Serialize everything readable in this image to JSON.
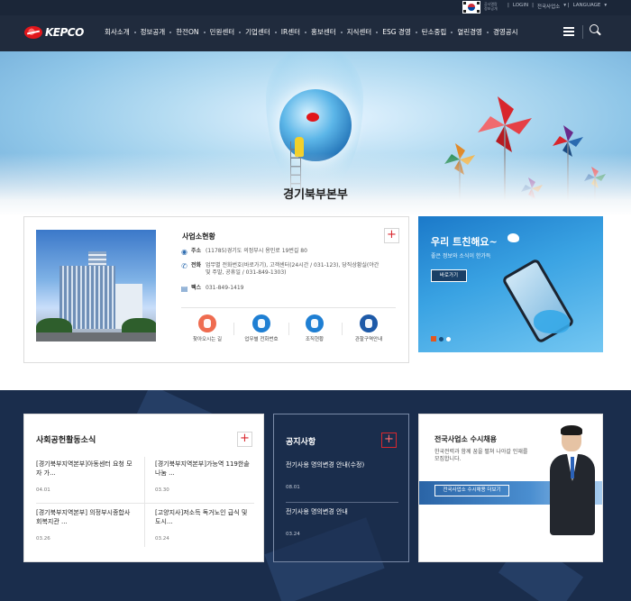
{
  "utility": {
    "flag_label": "Korean flag",
    "sub_lines": [
      "공사열람",
      "정보공개"
    ],
    "links": [
      "LOGIN",
      "전국사업소",
      "LANGUAGE"
    ]
  },
  "logo": {
    "text": "KEPCO"
  },
  "gnb": {
    "items": [
      "회사소개",
      "정보공개",
      "한전ON",
      "민원센터",
      "기업센터",
      "IR센터",
      "홍보센터",
      "지식센터",
      "ESG 경영",
      "탄소중립",
      "열린경영",
      "경영공시"
    ]
  },
  "hero": {
    "title": "경기북부본부"
  },
  "office": {
    "heading": "사업소현황",
    "address_label": "주소",
    "address": "(11785)경기도 의정부시 용민로 19번길 80",
    "phone_label": "전화",
    "phone": "업무별 전화번호(바로가기), 고객센터(24시간 / 031-123), 당직상황실(야간 및 주말, 공휴일 / 031-849-1303)",
    "fax_label": "팩스",
    "fax": "031-849-1419",
    "quick_links": [
      "찾아오시는 길",
      "업무별 전화번호",
      "조직현황",
      "관할구역안내"
    ]
  },
  "twitter": {
    "title": "우리 트친해요~",
    "desc": "좋은 정보와 소식이 한가득",
    "button": "바로가기"
  },
  "social": {
    "title": "사회공헌활동소식",
    "items": [
      {
        "title": "[경기북부지역본부]아동센터 요청 모자 가...",
        "date": "04.01"
      },
      {
        "title": "[경기북부지역본부]가능역 119한솥나눔 ...",
        "date": "03.30"
      },
      {
        "title": "[경기북부지역본부] 의정부시종합사회복지관 ...",
        "date": "03.26"
      },
      {
        "title": "[고양지사]저소득 독거노인 급식 및 도시...",
        "date": "03.24"
      }
    ]
  },
  "notice": {
    "title": "공지사항",
    "items": [
      {
        "title": "전기사용 명의변경 안내(수정)",
        "date": "08.01"
      },
      {
        "title": "전기사용 명의변경 안내",
        "date": "03.24"
      }
    ]
  },
  "recruit": {
    "title": "전국사업소 수시채용",
    "desc": "한국전력과 함께 꿈을 펼쳐 나아갈 인재를 모집합니다.",
    "button": "전국사업소 수시채용 더보기"
  },
  "plus_symbol": "+",
  "colors": {
    "navy": "#202b3d",
    "band": "#1a2d4c",
    "accent_red": "#d9272e",
    "twitter_blue": "#3aa3e3"
  }
}
